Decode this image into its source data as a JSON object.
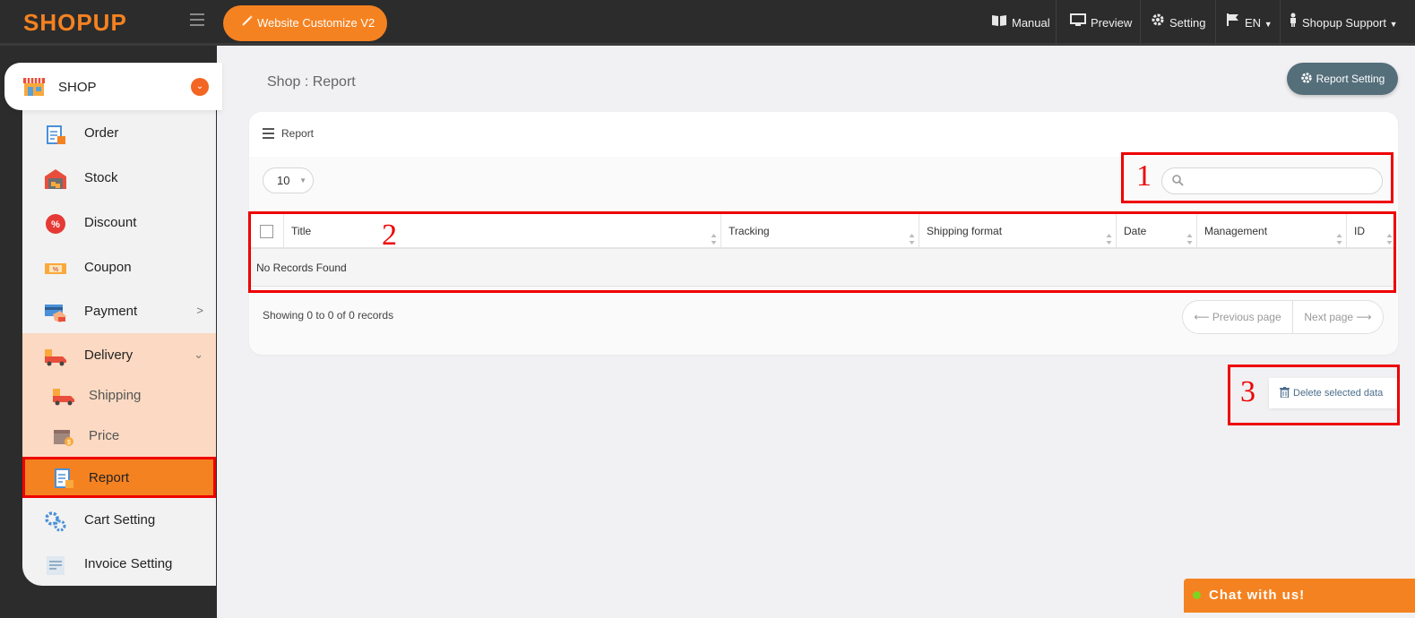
{
  "topbar": {
    "logo": "SHOPUP",
    "customize_label": "Website Customize V2",
    "manual": "Manual",
    "preview": "Preview",
    "setting": "Setting",
    "language": "EN",
    "account": "Shopup Support"
  },
  "sidebar": {
    "shop": "SHOP",
    "items": [
      {
        "label": "Order",
        "icon": "clipboard-icon"
      },
      {
        "label": "Stock",
        "icon": "warehouse-icon"
      },
      {
        "label": "Discount",
        "icon": "percent-badge-icon"
      },
      {
        "label": "Coupon",
        "icon": "coupon-icon"
      },
      {
        "label": "Payment",
        "icon": "payment-icon"
      },
      {
        "label": "Delivery",
        "icon": "truck-icon"
      }
    ],
    "delivery_sub": [
      {
        "label": "Shipping",
        "icon": "truck-icon"
      },
      {
        "label": "Price",
        "icon": "box-price-icon"
      },
      {
        "label": "Report",
        "icon": "report-icon"
      }
    ],
    "bottom_items": [
      {
        "label": "Cart Setting",
        "icon": "gears-icon"
      },
      {
        "label": "Invoice Setting",
        "icon": "invoice-icon"
      }
    ]
  },
  "main": {
    "title": "Shop : Report",
    "report_setting": "Report Setting",
    "card_title": "Report",
    "page_length": "10",
    "columns": [
      "Title",
      "Tracking",
      "Shipping format",
      "Date",
      "Management",
      "ID"
    ],
    "empty_message": "No Records Found",
    "info": "Showing 0 to 0 of 0 records",
    "prev": "⟵ Previous page",
    "next": "Next page ⟶",
    "delete": "Delete selected data"
  },
  "annotations": [
    "1",
    "2",
    "3"
  ],
  "chat": "Chat with us!",
  "colors": {
    "accent": "#f58220",
    "topbar": "#2c2c2c",
    "highlight": "#ee0000",
    "setting_btn": "#546e7a"
  }
}
